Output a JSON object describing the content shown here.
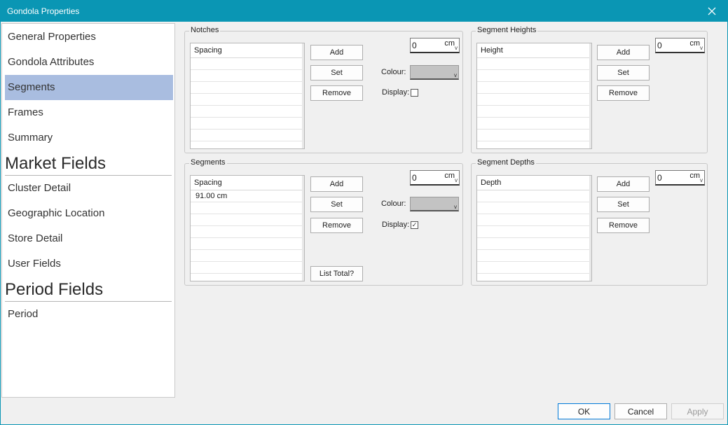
{
  "window": {
    "title": "Gondola Properties"
  },
  "sidebar": {
    "items": [
      {
        "label": "General Properties"
      },
      {
        "label": "Gondola Attributes"
      },
      {
        "label": "Segments"
      },
      {
        "label": "Frames"
      },
      {
        "label": "Summary"
      }
    ],
    "market_heading": "Market Fields",
    "market_items": [
      {
        "label": "Cluster Detail"
      },
      {
        "label": "Geographic Location"
      },
      {
        "label": "Store Detail"
      },
      {
        "label": "User Fields"
      }
    ],
    "period_heading": "Period Fields",
    "period_items": [
      {
        "label": "Period"
      }
    ],
    "selected": "Segments"
  },
  "notches": {
    "title": "Notches",
    "column_header": "Spacing",
    "rows": [],
    "add_label": "Add",
    "set_label": "Set",
    "remove_label": "Remove",
    "value": "0",
    "unit": "cm",
    "colour_label": "Colour:",
    "display_label": "Display:",
    "display_checked": false
  },
  "segment_heights": {
    "title": "Segment Heights",
    "column_header": "Height",
    "rows": [],
    "add_label": "Add",
    "set_label": "Set",
    "remove_label": "Remove",
    "value": "0",
    "unit": "cm"
  },
  "segments": {
    "title": "Segments",
    "column_header": "Spacing",
    "rows": [
      "91.00 cm"
    ],
    "add_label": "Add",
    "set_label": "Set",
    "remove_label": "Remove",
    "list_total_label": "List Total?",
    "value": "0",
    "unit": "cm",
    "colour_label": "Colour:",
    "display_label": "Display:",
    "display_checked": true,
    "checkmark": "✓"
  },
  "segment_depths": {
    "title": "Segment Depths",
    "column_header": "Depth",
    "rows": [],
    "add_label": "Add",
    "set_label": "Set",
    "remove_label": "Remove",
    "value": "0",
    "unit": "cm"
  },
  "footer": {
    "ok_label": "OK",
    "cancel_label": "Cancel",
    "apply_label": "Apply"
  },
  "icons": {
    "close": "close-icon",
    "dropdown": "chevron-down-icon",
    "chevron_glyph": "v"
  },
  "colors": {
    "titlebar": "#0a96b4",
    "selected_nav": "#a9bde0",
    "colour_swatch": "#c3c3c3"
  }
}
